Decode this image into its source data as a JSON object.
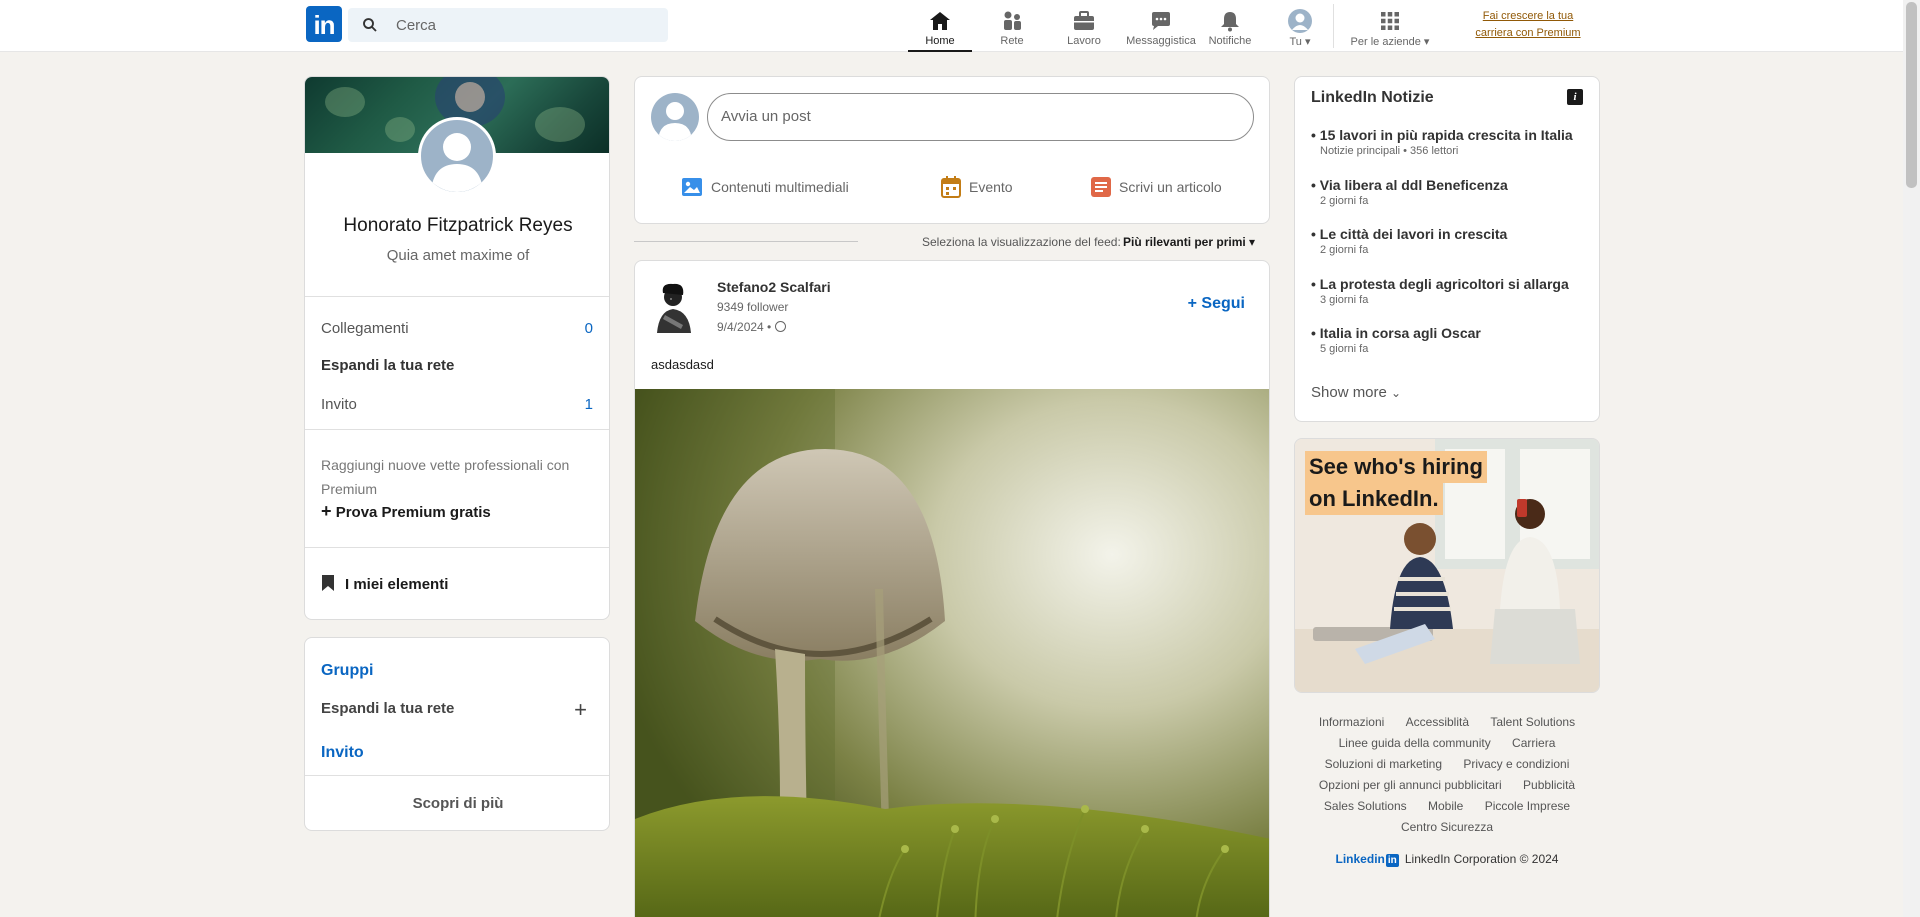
{
  "nav": {
    "logo_text": "in",
    "search_placeholder": "Cerca",
    "items": [
      {
        "label": "Home",
        "icon": "home-icon"
      },
      {
        "label": "Rete",
        "icon": "network-icon"
      },
      {
        "label": "Lavoro",
        "icon": "briefcase-icon"
      },
      {
        "label": "Messaggistica",
        "icon": "messaging-icon"
      },
      {
        "label": "Notifiche",
        "icon": "bell-icon"
      },
      {
        "label": "Tu",
        "icon": "avatar-icon"
      },
      {
        "label": "Per le aziende",
        "icon": "grid-icon"
      }
    ],
    "premium_link": "Fai crescere la tua carriera con Premium"
  },
  "profile": {
    "name": "Honorato Fitzpatrick Reyes",
    "headline": "Quia amet maxime of",
    "connections_label": "Collegamenti",
    "connections_value": "0",
    "expand_label": "Espandi la tua rete",
    "invites_label": "Invito",
    "invites_value": "1",
    "premium_text": "Raggiungi nuove vette professionali con Premium",
    "premium_cta": "Prova Premium gratis",
    "my_items": "I miei elementi"
  },
  "groups": {
    "groups_label": "Gruppi",
    "expand_label": "Espandi la tua rete",
    "invite_label": "Invito",
    "discover_more": "Scopri di più"
  },
  "composer": {
    "placeholder": "Avvia un post",
    "actions": [
      "Contenuti multimediali",
      "Evento",
      "Scrivi un articolo"
    ]
  },
  "feed_sort": {
    "label": "Seleziona la visualizzazione del feed:",
    "value": "Più rilevanti per primi"
  },
  "post": {
    "author": "Stefano2 Scalfari",
    "followers": "9349 follower",
    "date": "9/4/2024 •",
    "follow_label": "+ Segui",
    "text": "asdasdasd"
  },
  "news": {
    "title": "LinkedIn Notizie",
    "items": [
      {
        "headline": "• 15 lavori in più rapida crescita in Italia",
        "sub": "Notizie principali • 356 lettori"
      },
      {
        "headline": "• Via libera al ddl Beneficenza",
        "sub": "2 giorni fa"
      },
      {
        "headline": "• Le città dei lavori in crescita",
        "sub": "2 giorni fa"
      },
      {
        "headline": "• La protesta degli agricoltori si allarga",
        "sub": "3 giorni fa"
      },
      {
        "headline": "• Italia in corsa agli Oscar",
        "sub": "5 giorni fa"
      }
    ],
    "show_more": "Show more"
  },
  "ad": {
    "line1": "See who's hiring",
    "line2": "on LinkedIn."
  },
  "footer": {
    "links": [
      "Informazioni",
      "Accessiblità",
      "Talent Solutions",
      "Linee guida della community",
      "Carriera",
      "Soluzioni di marketing",
      "Privacy e condizioni",
      "Opzioni per gli annunci pubblicitari",
      "Pubblicità",
      "Sales Solutions",
      "Mobile",
      "Piccole Imprese",
      "Centro Sicurezza"
    ],
    "brand": "Linkedin",
    "copyright": "LinkedIn Corporation © 2024"
  },
  "colors": {
    "brand": "#0a66c2",
    "background": "#f4f2ee",
    "premium": "#915907"
  }
}
